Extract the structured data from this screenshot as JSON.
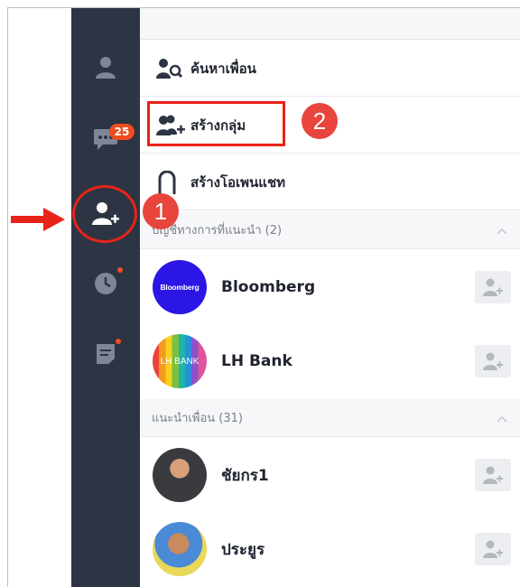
{
  "sidebar": {
    "chat_badge": "25"
  },
  "menu": {
    "search_friends": "ค้นหาเพื่อน",
    "create_group": "สร้างกลุ่ม",
    "create_open_chat": "สร้างโอเพนแชท"
  },
  "sections": {
    "official": "บัญชีทางการที่แนะนำ (2)",
    "suggested": "แนะนำเพื่อน (31)"
  },
  "official_accounts": [
    {
      "name": "Bloomberg",
      "avatar_text": "Bloomberg"
    },
    {
      "name": "LH Bank",
      "avatar_text": "LH BANK"
    }
  ],
  "suggested_friends": [
    {
      "name": "ชัยกร1"
    },
    {
      "name": "ประยูร"
    }
  ],
  "annotations": {
    "step1": "1",
    "step2": "2"
  },
  "colors": {
    "sidebar_bg": "#2d3443",
    "annotation_red": "#e8231a",
    "badge": "#f04d1e"
  }
}
